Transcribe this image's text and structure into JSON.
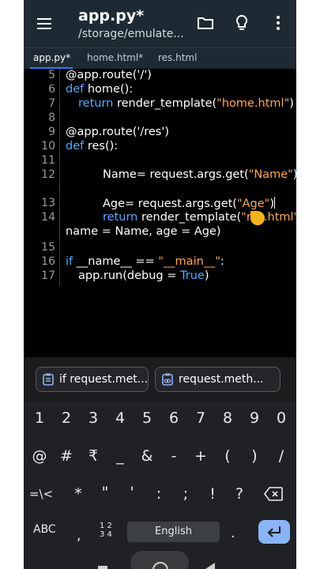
{
  "app": {
    "title": "app.py*",
    "path": "/storage/emulate..."
  },
  "toolbar": {
    "menu_icon": "hamburger-menu-icon",
    "folder_icon": "folder-icon",
    "hint_icon": "lightbulb-icon",
    "more_icon": "more-vertical-icon"
  },
  "tabs": [
    {
      "label": "app.py*",
      "active": true
    },
    {
      "label": "home.html*",
      "active": false
    },
    {
      "label": "res.html",
      "active": false
    }
  ],
  "editor": {
    "line_numbers": [
      "5",
      "6",
      "7",
      "8",
      "9",
      "10",
      "11",
      "12",
      "13",
      "14",
      "15",
      "16",
      "17"
    ],
    "lines": {
      "l5": "@app.route('/')",
      "l6_kw": "def",
      "l6_rest": " home():",
      "l7_kw": "return",
      "l7_fn": " render_template(",
      "l7_str": "\"home.html\"",
      "l7_end": ")",
      "l9": "@app.route('/res')",
      "l10_kw": "def",
      "l10_rest": " res():",
      "l12_a": "Name= request.args.get(",
      "l12_str": "\"Name\"",
      "l12_end": ")",
      "l13_a": "Age= request.args.get(",
      "l13_str": "\"Age\"",
      "l13_end": ")",
      "l14_kw": "return",
      "l14_fn": " render_template(",
      "l14_str": "\"res.html\"",
      "l14_end": ",",
      "l14_cont": "name = Name, age = Age)",
      "l16_kw": "if",
      "l16_a": " __name__ == ",
      "l16_str": "\"__main__\"",
      "l16_end": ":",
      "l17_a": "app.run(debug = ",
      "l17_kw": "True",
      "l17_end": ")"
    }
  },
  "suggestions": [
    {
      "label": "if request.met...",
      "icon": "clipboard-icon"
    },
    {
      "label": "request.meth...",
      "icon": "clipboard-link-icon"
    }
  ],
  "keyboard": {
    "row1": [
      "1",
      "2",
      "3",
      "4",
      "5",
      "6",
      "7",
      "8",
      "9",
      "0"
    ],
    "row2": [
      "@",
      "#",
      "₹",
      "_",
      "&",
      "-",
      "+",
      "(",
      ")",
      "/"
    ],
    "row3": [
      "=\\<",
      "*",
      "\"",
      "'",
      ":",
      ";",
      "!",
      "?"
    ],
    "abc": "ABC",
    "comma": ",",
    "numtoggle_top": "1 2",
    "numtoggle_bottom": "3 4",
    "space": "English",
    "period": ".",
    "backspace_icon": "backspace-icon",
    "enter_icon": "enter-icon"
  }
}
